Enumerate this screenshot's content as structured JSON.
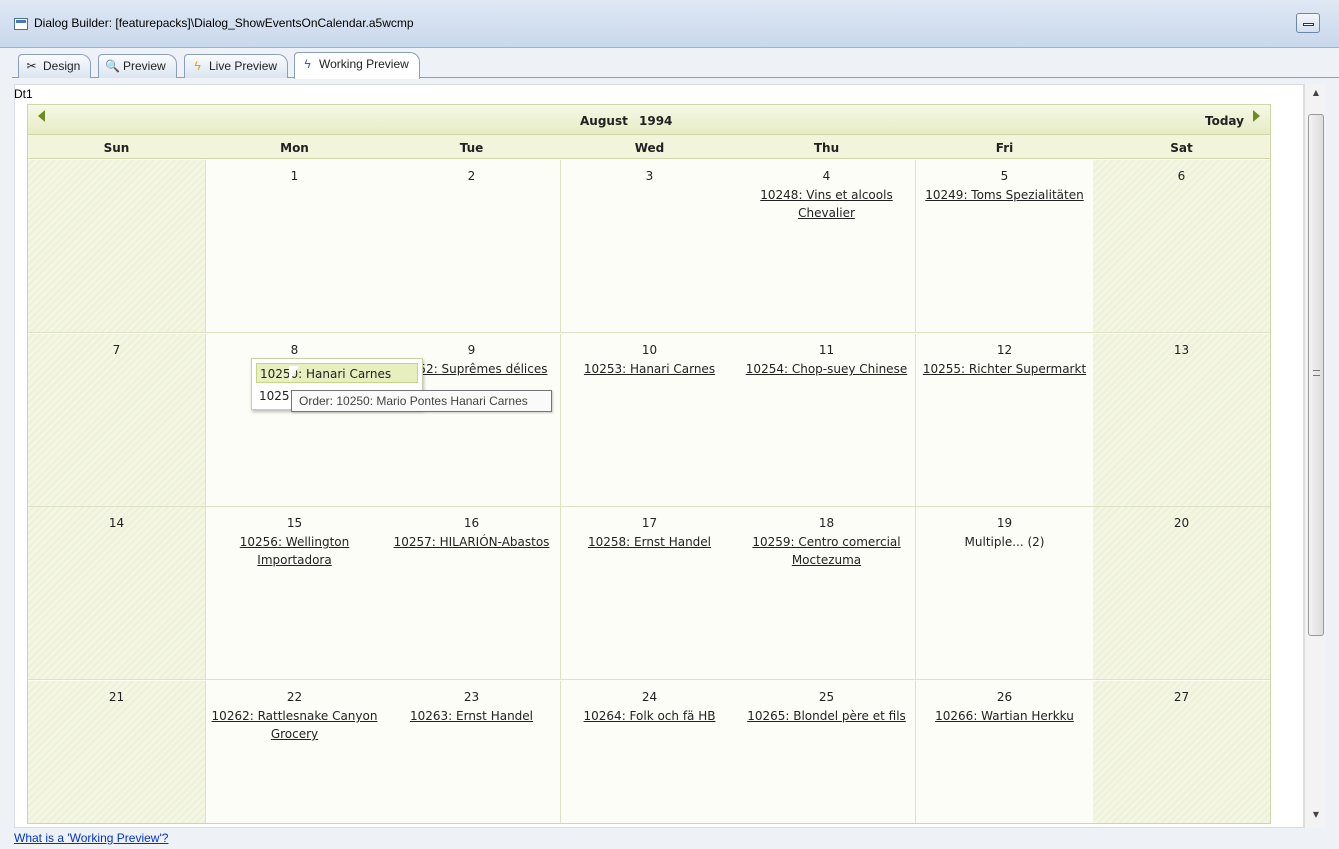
{
  "window": {
    "title": "Dialog Builder: [featurepacks]\\Dialog_ShowEventsOnCalendar.a5wcmp",
    "icon": "dialog-builder-icon"
  },
  "tabs": [
    {
      "label": "Design",
      "icon": "scissors-icon"
    },
    {
      "label": "Preview",
      "icon": "magnifier-icon"
    },
    {
      "label": "Live Preview",
      "icon": "lightning-icon"
    },
    {
      "label": "Working Preview",
      "icon": "lightning-icon",
      "active": true
    }
  ],
  "control_label": "Dt1",
  "calendar": {
    "month": "August",
    "year": "1994",
    "today_label": "Today",
    "days_of_week": [
      "Sun",
      "Mon",
      "Tue",
      "Wed",
      "Thu",
      "Fri",
      "Sat"
    ],
    "weeks": [
      [
        {
          "day": "",
          "events": []
        },
        {
          "day": "1",
          "events": []
        },
        {
          "day": "2",
          "events": []
        },
        {
          "day": "3",
          "events": []
        },
        {
          "day": "4",
          "events": [
            "10248: Vins et alcools Chevalier"
          ]
        },
        {
          "day": "5",
          "events": [
            "10249: Toms Spezialitäten"
          ]
        },
        {
          "day": "6",
          "events": []
        }
      ],
      [
        {
          "day": "7",
          "events": []
        },
        {
          "day": "8",
          "events": []
        },
        {
          "day": "9",
          "events": [
            "10252: Suprêmes délices"
          ]
        },
        {
          "day": "10",
          "events": [
            "10253: Hanari Carnes"
          ]
        },
        {
          "day": "11",
          "events": [
            "10254: Chop-suey Chinese"
          ]
        },
        {
          "day": "12",
          "events": [
            "10255: Richter Supermarkt"
          ]
        },
        {
          "day": "13",
          "events": []
        }
      ],
      [
        {
          "day": "14",
          "events": []
        },
        {
          "day": "15",
          "events": [
            "10256: Wellington Importadora"
          ]
        },
        {
          "day": "16",
          "events": [
            "10257: HILARIÓN-Abastos"
          ]
        },
        {
          "day": "17",
          "events": [
            "10258: Ernst Handel"
          ]
        },
        {
          "day": "18",
          "events": [
            "10259: Centro comercial Moctezuma"
          ]
        },
        {
          "day": "19",
          "events": [
            "Multiple... (2)"
          ]
        },
        {
          "day": "20",
          "events": []
        }
      ],
      [
        {
          "day": "21",
          "events": []
        },
        {
          "day": "22",
          "events": [
            "10262: Rattlesnake Canyon Grocery"
          ]
        },
        {
          "day": "23",
          "events": [
            "10263: Ernst Handel"
          ]
        },
        {
          "day": "24",
          "events": [
            "10264: Folk och fä HB"
          ]
        },
        {
          "day": "25",
          "events": [
            "10265: Blondel père et fils"
          ]
        },
        {
          "day": "26",
          "events": [
            "10266: Wartian Herkku"
          ]
        },
        {
          "day": "27",
          "events": []
        }
      ]
    ],
    "popup": {
      "items": [
        "10250: Hanari Carnes",
        "10251:"
      ]
    },
    "tooltip": "Order: 10250: Mario Pontes Hanari Carnes"
  },
  "help_link": "What is a 'Working Preview'?"
}
